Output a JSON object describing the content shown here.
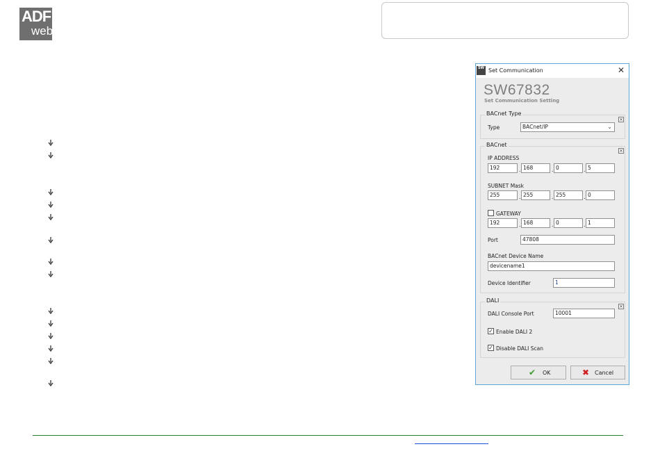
{
  "logo": {
    "line1": "ADF",
    "line2": "web"
  },
  "dialog": {
    "window_title": "Set Communication",
    "title_icon_text": "SW",
    "close_glyph": "✕",
    "product_code": "SW67832",
    "subtitle": "Set Communication Setting",
    "bacnet_type": {
      "label": "BACnet Type",
      "type_label": "Type",
      "type_value": "BACnet/IP",
      "collapse_glyph": "×"
    },
    "bacnet": {
      "label": "BACnet",
      "collapse_glyph": "×",
      "ip_label": "IP ADDRESS",
      "ip": [
        "192",
        "168",
        "0",
        "5"
      ],
      "subnet_label": "SUBNET Mask",
      "subnet": [
        "255",
        "255",
        "255",
        "0"
      ],
      "gateway_label": "GATEWAY",
      "gateway_checked": false,
      "gateway": [
        "192",
        "168",
        "0",
        "1"
      ],
      "port_label": "Port",
      "port_value": "47808",
      "device_name_label": "BACnet Device Name",
      "device_name_value": "devicename1",
      "device_id_label": "Device Identifier",
      "device_id_value": "1",
      "dot": "."
    },
    "dali": {
      "label": "DALI",
      "collapse_glyph": "×",
      "console_port_label": "DALI Console Port",
      "console_port_value": "10001",
      "enable_dali2_label": "Enable DALI 2",
      "enable_dali2_checked": true,
      "disable_scan_label": "Disable DALI Scan",
      "disable_scan_checked": true,
      "check_glyph": "✓"
    },
    "buttons": {
      "ok_label": "OK",
      "ok_icon": "✔",
      "cancel_label": "Cancel",
      "cancel_icon": "✖"
    }
  },
  "colors": {
    "footer_line": "#2e7d32",
    "link": "#1a4fd8",
    "dialog_border": "#5aa9d8",
    "ok_check": "#3a9a2a",
    "cancel_x": "#d02020"
  }
}
